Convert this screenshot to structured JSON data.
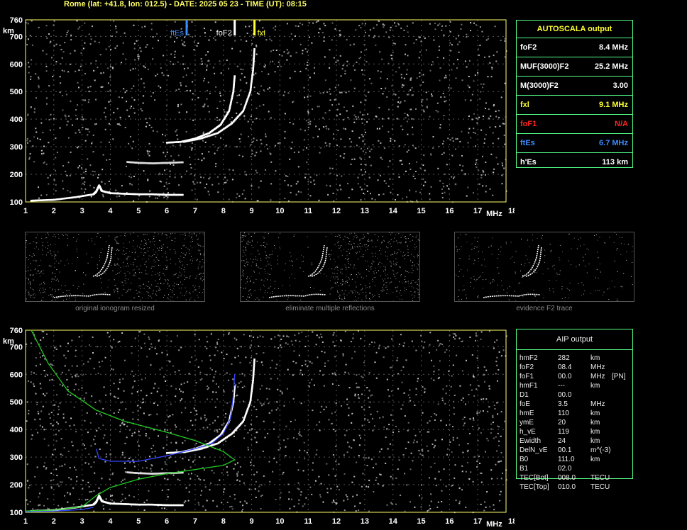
{
  "header": "Rome (lat: +41.8, lon: 012.5) - DATE: 2025 05 23 - TIME (UT): 08:15",
  "chart_data": [
    {
      "type": "scatter",
      "name": "ionogram-autoscala",
      "xlabel": "MHz",
      "ylabel": "km",
      "xlim": [
        1,
        18
      ],
      "ylim": [
        100,
        760
      ],
      "xticks": [
        1,
        2,
        3,
        4,
        5,
        6,
        7,
        8,
        9,
        10,
        11,
        12,
        13,
        14,
        15,
        16,
        17,
        18
      ],
      "yticks": [
        100,
        200,
        300,
        400,
        500,
        600,
        700,
        760
      ],
      "grid": true,
      "markers": [
        {
          "label": "ftEs",
          "x": 6.7,
          "color": "#3b8cff"
        },
        {
          "label": "foF2",
          "x": 8.4,
          "color": "#ffffff"
        },
        {
          "label": "fxI",
          "x": 9.1,
          "color": "#ffff33"
        }
      ],
      "traces": [
        {
          "name": "Es",
          "color": "#ffffff",
          "points": [
            [
              1.2,
              105
            ],
            [
              2.0,
              108
            ],
            [
              2.8,
              118
            ],
            [
              3.4,
              128
            ],
            [
              3.5,
              138
            ],
            [
              3.6,
              160
            ],
            [
              3.7,
              140
            ],
            [
              4.0,
              132
            ],
            [
              4.5,
              130
            ],
            [
              5.0,
              128
            ],
            [
              5.5,
              128
            ],
            [
              6.0,
              126
            ],
            [
              6.6,
              126
            ]
          ]
        },
        {
          "name": "F2-o",
          "color": "#ffffff",
          "points": [
            [
              6.0,
              315
            ],
            [
              6.5,
              318
            ],
            [
              7.0,
              330
            ],
            [
              7.5,
              350
            ],
            [
              7.9,
              380
            ],
            [
              8.2,
              430
            ],
            [
              8.35,
              500
            ],
            [
              8.4,
              560
            ]
          ]
        },
        {
          "name": "F2-x",
          "color": "#ffffff",
          "points": [
            [
              6.6,
              318
            ],
            [
              7.2,
              330
            ],
            [
              7.8,
              350
            ],
            [
              8.3,
              385
            ],
            [
              8.7,
              430
            ],
            [
              8.95,
              500
            ],
            [
              9.05,
              580
            ],
            [
              9.1,
              660
            ]
          ]
        },
        {
          "name": "multiple",
          "color": "#dddddd",
          "points": [
            [
              4.6,
              245
            ],
            [
              5.0,
              242
            ],
            [
              5.5,
              240
            ],
            [
              6.0,
              242
            ],
            [
              6.6,
              244
            ]
          ]
        }
      ]
    },
    {
      "type": "line",
      "name": "ionogram-aip",
      "xlabel": "MHz",
      "ylabel": "km",
      "xlim": [
        1,
        18
      ],
      "ylim": [
        100,
        760
      ],
      "xticks": [
        1,
        2,
        3,
        4,
        5,
        6,
        7,
        8,
        9,
        10,
        11,
        12,
        13,
        14,
        15,
        16,
        17,
        18
      ],
      "yticks": [
        100,
        200,
        300,
        400,
        500,
        600,
        700,
        760
      ],
      "grid": true,
      "series": [
        {
          "name": "virtual-fit",
          "color": "#3344ff",
          "points": [
            [
              3.5,
              330
            ],
            [
              3.6,
              295
            ],
            [
              4.0,
              285
            ],
            [
              5.0,
              285
            ],
            [
              6.0,
              305
            ],
            [
              7.0,
              330
            ],
            [
              7.6,
              350
            ],
            [
              8.0,
              385
            ],
            [
              8.25,
              440
            ],
            [
              8.35,
              520
            ],
            [
              8.4,
              600
            ]
          ]
        },
        {
          "name": "virtual-low",
          "color": "#3344ff",
          "points": [
            [
              1.0,
              102
            ],
            [
              2.0,
              104
            ],
            [
              3.0,
              110
            ],
            [
              3.4,
              118
            ]
          ]
        },
        {
          "name": "true-height",
          "color": "#22cc22",
          "points": [
            [
              1.2,
              760
            ],
            [
              1.8,
              640
            ],
            [
              2.5,
              540
            ],
            [
              3.5,
              470
            ],
            [
              4.5,
              430
            ],
            [
              6.0,
              390
            ],
            [
              7.0,
              360
            ],
            [
              8.0,
              320
            ],
            [
              8.4,
              290
            ],
            [
              8.0,
              270
            ],
            [
              7.0,
              255
            ],
            [
              6.0,
              240
            ],
            [
              5.0,
              220
            ],
            [
              4.0,
              190
            ],
            [
              3.5,
              160
            ],
            [
              3.0,
              120
            ],
            [
              2.0,
              108
            ],
            [
              1.0,
              105
            ]
          ]
        }
      ]
    }
  ],
  "thumbs": {
    "captions": [
      "original ionogram resized",
      "eliminate multiple reflections",
      "evidence F2 trace"
    ]
  },
  "autoscala": {
    "title": "AUTOSCALA output",
    "rows": [
      {
        "key": "foF2",
        "value": "8.4 MHz",
        "color": "#ffffff"
      },
      {
        "key": "MUF(3000)F2",
        "value": "25.2 MHz",
        "color": "#ffffff"
      },
      {
        "key": "M(3000)F2",
        "value": "3.00",
        "color": "#ffffff"
      },
      {
        "key": "fxl",
        "value": "9.1 MHz",
        "color": "#ffff33"
      },
      {
        "key": "foF1",
        "value": "N/A",
        "color": "#ff2222"
      },
      {
        "key": "ftEs",
        "value": "6.7 MHz",
        "color": "#3b8cff"
      },
      {
        "key": "h'Es",
        "value": "113 km",
        "color": "#ffffff"
      }
    ]
  },
  "aip": {
    "title": "AIP output",
    "rows": [
      [
        "hmF2",
        "282",
        "km",
        ""
      ],
      [
        "foF2",
        "08.4",
        "MHz",
        ""
      ],
      [
        "foF1",
        "00.0",
        "MHz",
        "[PN]"
      ],
      [
        "hmF1",
        "---",
        "km",
        ""
      ],
      [
        "D1",
        "00.0",
        "",
        ""
      ],
      [
        "foE",
        "3.5",
        "MHz",
        ""
      ],
      [
        "hmE",
        "110",
        "km",
        ""
      ],
      [
        "ymE",
        "20",
        "km",
        ""
      ],
      [
        "h_vE",
        "119",
        "km",
        ""
      ],
      [
        "Ewidth",
        "24",
        "km",
        ""
      ],
      [
        "DelN_vE",
        "00.1",
        "m^(-3)",
        ""
      ],
      [
        "B0",
        "111.0",
        "km",
        ""
      ],
      [
        "B1",
        "02.0",
        "",
        ""
      ],
      [
        "TEC[Bot]",
        "008.0",
        "TECU",
        ""
      ],
      [
        "TEC[Top]",
        "010.0",
        "TECU",
        ""
      ]
    ]
  }
}
